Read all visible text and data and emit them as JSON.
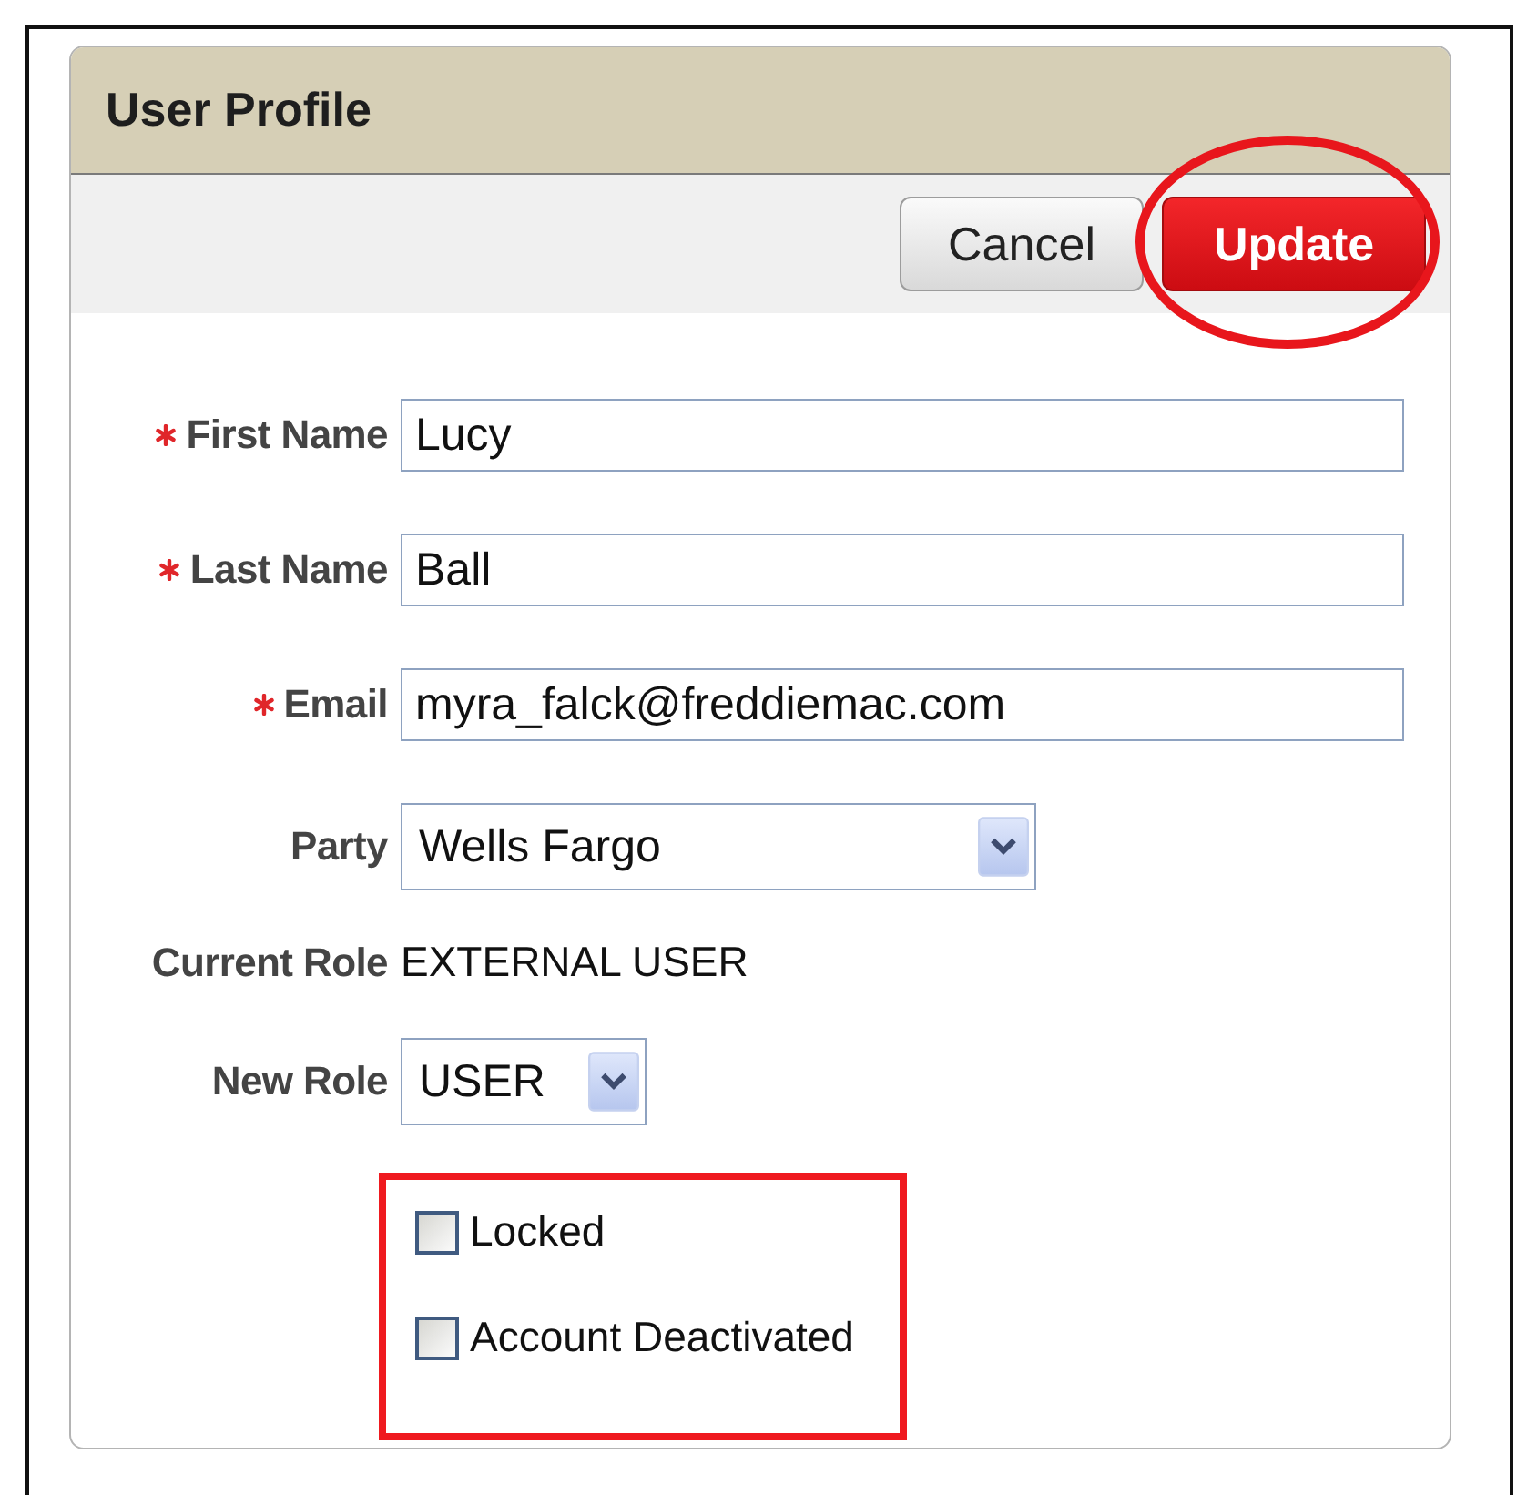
{
  "panel": {
    "title": "User Profile"
  },
  "buttons": [
    {
      "label": "Cancel",
      "kind": "secondary",
      "highlighted": false
    },
    {
      "label": "Update",
      "kind": "primary",
      "highlighted": true
    }
  ],
  "fields": [
    {
      "label": "First Name",
      "required": true,
      "kind": "text",
      "value": "Lucy"
    },
    {
      "label": "Last Name",
      "required": true,
      "kind": "text",
      "value": "Ball"
    },
    {
      "label": "Email",
      "required": true,
      "kind": "text",
      "value": "myra_falck@freddiemac.com"
    },
    {
      "label": "Party",
      "required": false,
      "kind": "select",
      "value": "Wells Fargo"
    },
    {
      "label": "Current Role",
      "required": false,
      "kind": "static",
      "value": "EXTERNAL USER"
    },
    {
      "label": "New Role",
      "required": false,
      "kind": "select-small",
      "value": "USER"
    }
  ],
  "checkboxes": {
    "highlighted": true,
    "items": [
      {
        "label": "Locked",
        "checked": false
      },
      {
        "label": "Account Deactivated",
        "checked": false
      }
    ]
  }
}
